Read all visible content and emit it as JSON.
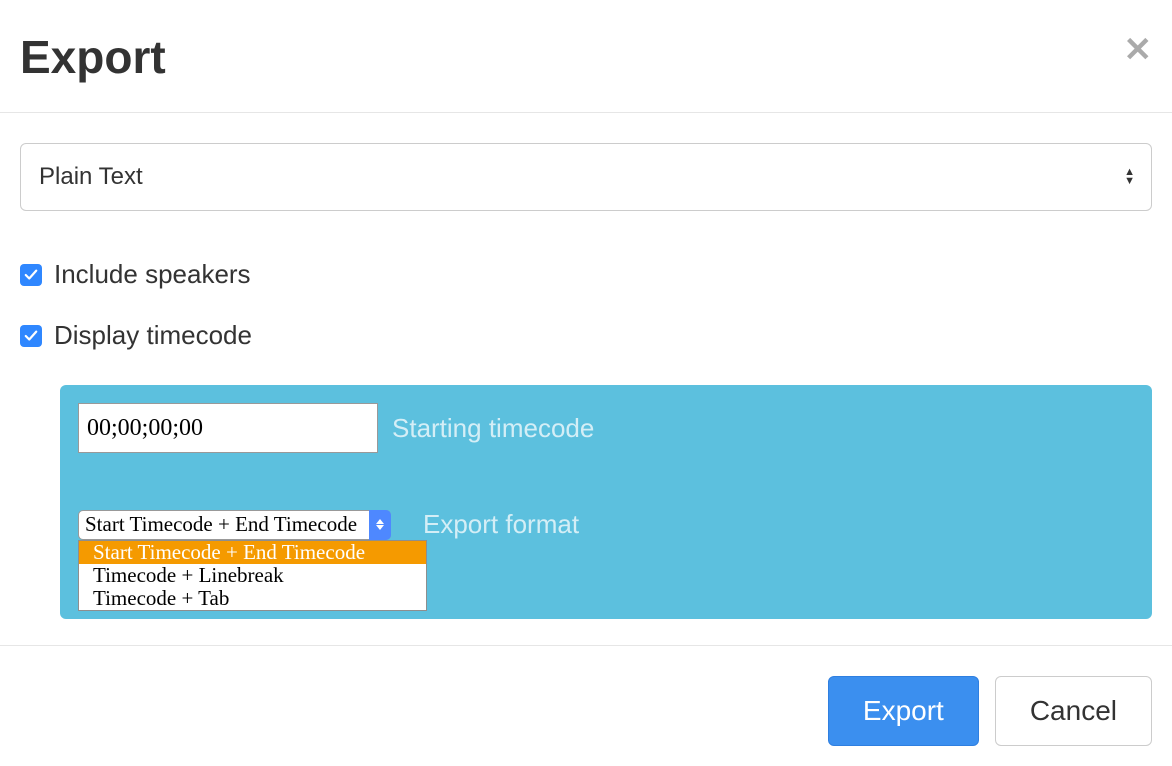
{
  "dialog": {
    "title": "Export"
  },
  "format_select": {
    "value": "Plain Text"
  },
  "options": {
    "include_speakers_label": "Include speakers",
    "include_speakers_checked": true,
    "display_timecode_label": "Display timecode",
    "display_timecode_checked": true
  },
  "timecode": {
    "starting_value": "00;00;00;00",
    "starting_label": "Starting timecode",
    "export_format_label": "Export format",
    "export_format_value": "Start Timecode + End Timecode",
    "export_format_options": [
      "Start Timecode + End Timecode",
      "Timecode + Linebreak",
      "Timecode + Tab"
    ]
  },
  "footer": {
    "export_label": "Export",
    "cancel_label": "Cancel"
  }
}
